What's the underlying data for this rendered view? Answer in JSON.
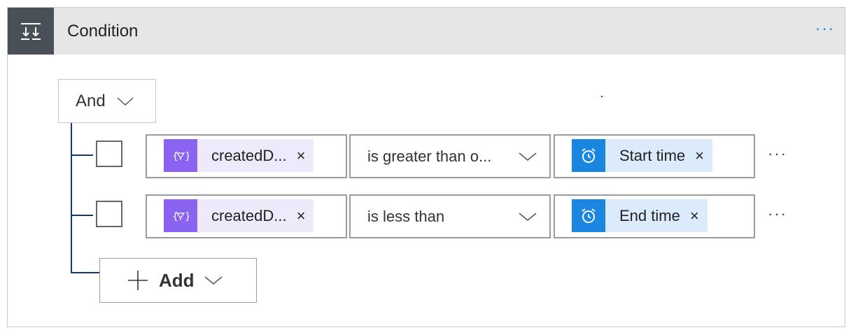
{
  "header": {
    "title": "Condition",
    "more_label": "···",
    "icon": "condition-icon"
  },
  "group": {
    "operator_label": "And",
    "icon": "chevron-down-icon"
  },
  "rows": [
    {
      "left_token": {
        "label": "createdD...",
        "close": "×",
        "icon": "expression-icon",
        "color": "#8a63f0"
      },
      "operator": "is greater than o...",
      "right_token": {
        "label": "Start time",
        "close": "×",
        "icon": "alarm-clock-icon",
        "color": "#1a86e0"
      },
      "more_label": "···"
    },
    {
      "left_token": {
        "label": "createdD...",
        "close": "×",
        "icon": "expression-icon",
        "color": "#8a63f0"
      },
      "operator": "is less than",
      "right_token": {
        "label": "End time",
        "close": "×",
        "icon": "alarm-clock-icon",
        "color": "#1a86e0"
      },
      "more_label": "···"
    }
  ],
  "add_button": {
    "label": "Add",
    "icon": "plus-icon"
  },
  "colors": {
    "header_icon_bg": "#4a5058",
    "accent": "#0078d4",
    "tree_line": "#0a3a78"
  }
}
